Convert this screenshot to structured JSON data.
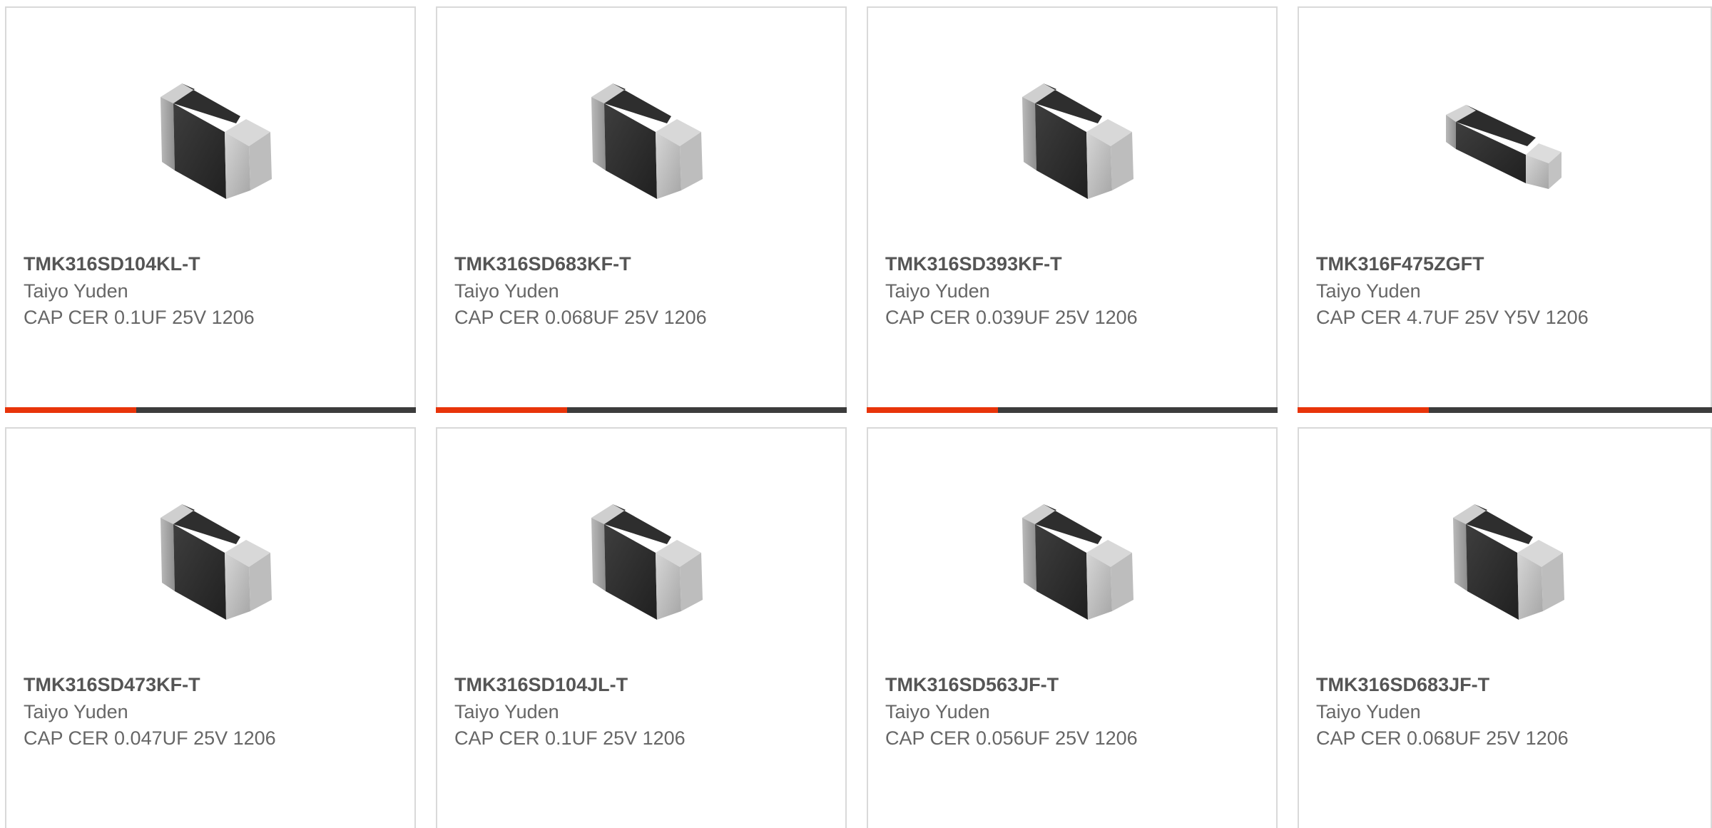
{
  "colors": {
    "accent": "#e8340a",
    "bar": "#3c3c3c",
    "border": "#d9d9d9"
  },
  "products": [
    {
      "part_number": "TMK316SD104KL-T",
      "manufacturer": "Taiyo Yuden",
      "description": "CAP CER 0.1UF 25V 1206",
      "image": "capacitor-chip-image"
    },
    {
      "part_number": "TMK316SD683KF-T",
      "manufacturer": "Taiyo Yuden",
      "description": "CAP CER 0.068UF 25V 1206",
      "image": "capacitor-chip-image"
    },
    {
      "part_number": "TMK316SD393KF-T",
      "manufacturer": "Taiyo Yuden",
      "description": "CAP CER 0.039UF 25V 1206",
      "image": "capacitor-chip-image"
    },
    {
      "part_number": "TMK316F475ZGFT",
      "manufacturer": "Taiyo Yuden",
      "description": "CAP CER 4.7UF 25V Y5V 1206",
      "image": "capacitor-chip-flat-image"
    },
    {
      "part_number": "TMK316SD473KF-T",
      "manufacturer": "Taiyo Yuden",
      "description": "CAP CER 0.047UF 25V 1206",
      "image": "capacitor-chip-image"
    },
    {
      "part_number": "TMK316SD104JL-T",
      "manufacturer": "Taiyo Yuden",
      "description": "CAP CER 0.1UF 25V 1206",
      "image": "capacitor-chip-image"
    },
    {
      "part_number": "TMK316SD563JF-T",
      "manufacturer": "Taiyo Yuden",
      "description": "CAP CER 0.056UF 25V 1206",
      "image": "capacitor-chip-image"
    },
    {
      "part_number": "TMK316SD683JF-T",
      "manufacturer": "Taiyo Yuden",
      "description": "CAP CER 0.068UF 25V 1206",
      "image": "capacitor-chip-image"
    }
  ]
}
